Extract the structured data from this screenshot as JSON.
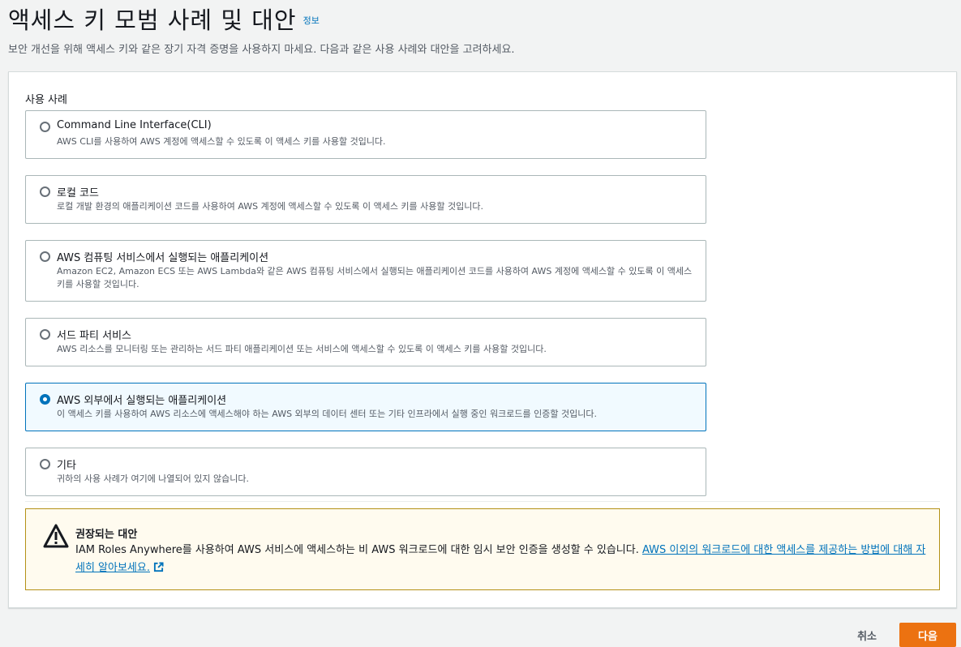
{
  "header": {
    "title": "액세스 키 모범 사례 및 대안",
    "info_link": "정보",
    "description": "보안 개선을 위해 액세스 키와 같은 장기 자격 증명을 사용하지 마세요. 다음과 같은 사용 사례와 대안을 고려하세요."
  },
  "use_cases": {
    "label": "사용 사례",
    "selected_index": 4,
    "options": [
      {
        "title": "Command Line Interface(CLI)",
        "description": "AWS CLI를 사용하여 AWS 계정에 액세스할 수 있도록 이 액세스 키를 사용할 것입니다."
      },
      {
        "title": "로컬 코드",
        "description": "로컬 개발 환경의 애플리케이션 코드를 사용하여 AWS 계정에 액세스할 수 있도록 이 액세스 키를 사용할 것입니다."
      },
      {
        "title": "AWS 컴퓨팅 서비스에서 실행되는 애플리케이션",
        "description": "Amazon EC2, Amazon ECS 또는 AWS Lambda와 같은 AWS 컴퓨팅 서비스에서 실행되는 애플리케이션 코드를 사용하여 AWS 계정에 액세스할 수 있도록 이 액세스 키를 사용할 것입니다."
      },
      {
        "title": "서드 파티 서비스",
        "description": "AWS 리소스를 모니터링 또는 관리하는 서드 파티 애플리케이션 또는 서비스에 액세스할 수 있도록 이 액세스 키를 사용할 것입니다."
      },
      {
        "title": "AWS 외부에서 실행되는 애플리케이션",
        "description": "이 액세스 키를 사용하여 AWS 리소스에 액세스해야 하는 AWS 외부의 데이터 센터 또는 기타 인프라에서 실행 중인 워크로드를 인증할 것입니다."
      },
      {
        "title": "기타",
        "description": "귀하의 사용 사례가 여기에 나열되어 있지 않습니다."
      }
    ]
  },
  "alert": {
    "title": "권장되는 대안",
    "body": "IAM Roles Anywhere를 사용하여 AWS 서비스에 액세스하는 비 AWS 워크로드에 대한 임시 보안 인증을 생성할 수 있습니다. ",
    "link": "AWS 이외의 워크로드에 대한 액세스를 제공하는 방법에 대해 자세히 알아보세요.",
    "warning_icon": "warning-icon",
    "external_icon": "external-link-icon",
    "border_color": "#b49116",
    "background_color": "#fffbef"
  },
  "footer": {
    "cancel_label": "취소",
    "next_label": "다음",
    "primary_color": "#ec7211"
  }
}
